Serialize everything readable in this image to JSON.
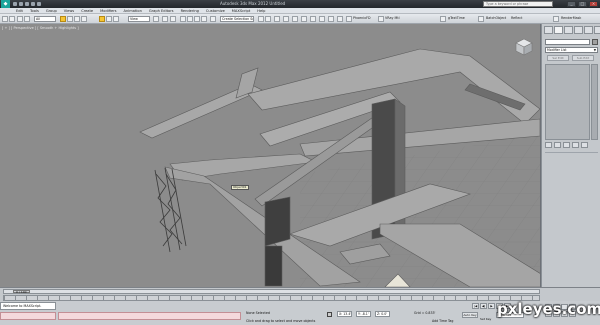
{
  "window": {
    "title": "Autodesk 3ds Max 2012   Untitled",
    "search_placeholder": "Type a keyword or phrase"
  },
  "menu": [
    "Edit",
    "Tools",
    "Group",
    "Views",
    "Create",
    "Modifiers",
    "Animation",
    "Graph Editors",
    "Rendering",
    "Customize",
    "MAXScript",
    "Help"
  ],
  "toolbar": {
    "filter": "All",
    "ref_coord": "View",
    "named_sel": "Create Selection Set",
    "plugins": [
      "PhoenixFD",
      "VRay Mtl",
      "gTextTime",
      "BatchObject",
      "Reflect",
      "RenderMask"
    ]
  },
  "viewport": {
    "label": "[ + ] [ Perspective ] [ Smooth + Highlights ]",
    "object_label": "Object01"
  },
  "command_panel": {
    "modifier_list": "Modifier List",
    "buttons": [
      "Sel Edit",
      "Sub Edit"
    ]
  },
  "timeline": {
    "frame": "0 / 100"
  },
  "status": {
    "maxscript": "Welcome to MAXScript.",
    "selection": "None Selected",
    "prompt": "Click and drag to select and move objects",
    "x": "X: 13.4'",
    "y": "Y: -8.1'",
    "z": "Z: 0.0'",
    "grid": "Grid = 0.833'",
    "add_time_tag": "Add Time Tag",
    "auto_key": "Auto Key",
    "set_key": "Set Key",
    "key_filter": "Selected"
  },
  "watermark": "pxleyes.com",
  "colors": {
    "viewport_bg": "#8c8c8c",
    "geometry": "#a3a3a3",
    "selection": "#f6c533"
  }
}
